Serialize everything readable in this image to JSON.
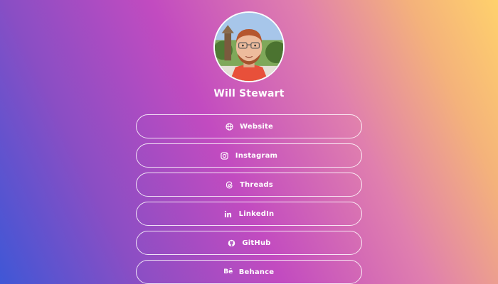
{
  "profile": {
    "name": "Will Stewart",
    "avatar_icon": "profile-photo"
  },
  "links": [
    {
      "label": "Website",
      "icon": "globe-icon"
    },
    {
      "label": "Instagram",
      "icon": "instagram-icon"
    },
    {
      "label": "Threads",
      "icon": "threads-icon"
    },
    {
      "label": "LinkedIn",
      "icon": "linkedin-icon"
    },
    {
      "label": "GitHub",
      "icon": "github-icon"
    },
    {
      "label": "Behance",
      "icon": "behance-icon"
    }
  ],
  "colors": {
    "gradient_start": "#3f57d6",
    "gradient_mid": "#c24bc0",
    "gradient_end": "#ffd16c",
    "text": "#ffffff"
  }
}
